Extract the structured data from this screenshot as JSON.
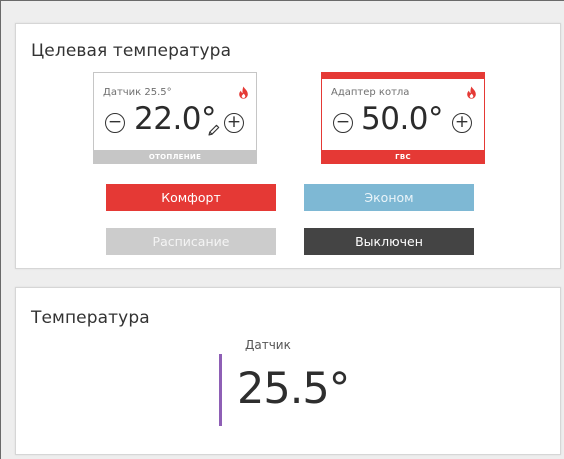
{
  "target_card": {
    "title": "Целевая температура",
    "heating_tile": {
      "label": "Датчик 25.5°",
      "value": "22.0°",
      "footer": "ОТОПЛЕНИЕ",
      "minus_symbol": "−",
      "plus_symbol": "+",
      "flame_icon": "flame-icon",
      "edit_icon": "pencil-icon"
    },
    "dhw_tile": {
      "label": "Адаптер котла",
      "value": "50.0°",
      "footer": "ГВС",
      "minus_symbol": "−",
      "plus_symbol": "+",
      "flame_icon": "flame-icon",
      "accent_color": "#e53935"
    },
    "modes": {
      "comfort": "Комфорт",
      "econom": "Эконом",
      "schedule": "Расписание",
      "off": "Выключен"
    }
  },
  "temperature_card": {
    "title": "Температура",
    "sensor_label": "Датчик",
    "sensor_value": "25.5°",
    "accent_color": "#8e5fb5"
  },
  "colors": {
    "comfort": "#e53935",
    "econom": "#7eb8d4",
    "schedule": "#cccccc",
    "off": "#444444"
  }
}
